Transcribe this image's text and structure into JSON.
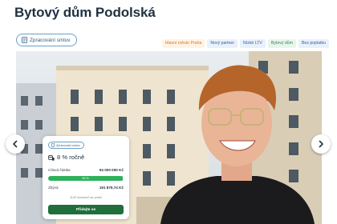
{
  "page": {
    "title": "Bytový dům Podolská"
  },
  "status_chip": {
    "label": "Zpracování smluv",
    "icon": "document-icon"
  },
  "tags": [
    {
      "label": "Hlavní město Praha",
      "color": "#d97a18"
    },
    {
      "label": "Nový partner",
      "color": "#2f5fa8"
    },
    {
      "label": "Nízké LTV",
      "color": "#2f5fa8"
    },
    {
      "label": "Bytový dům",
      "color": "#2e8a4e"
    },
    {
      "label": "Bez poplatku",
      "color": "#2f5fa8"
    }
  ],
  "carousel": {
    "prev_icon": "chevron-left-icon",
    "next_icon": "chevron-right-icon"
  },
  "card": {
    "status_label": "Zpracování smluv",
    "rate": "8 % ročně",
    "target_label": "Cílová částka",
    "target_value": "94 000 000 Kč",
    "progress_label": "99 %",
    "progress_value": 0.99,
    "remaining_label": "Zbývá",
    "remaining_value": "191 879,74 Kč",
    "investors": "1142 investorů se podílí",
    "invest_button": "Přidejte se"
  },
  "colors": {
    "accent_green": "#1f6e3c",
    "progress_green": "#2fb15c",
    "title": "#213241"
  }
}
